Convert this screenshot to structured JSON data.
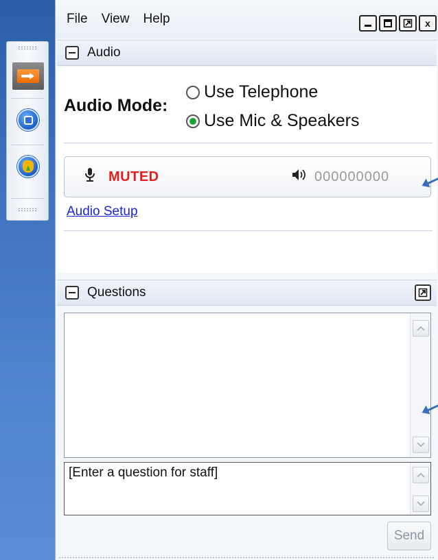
{
  "menu": {
    "items": [
      "File",
      "View",
      "Help"
    ]
  },
  "window_controls": {
    "minimize_icon": "minimize-icon",
    "maximize_icon": "maximize-icon",
    "restore_icon": "restore-icon",
    "close_glyph": "x"
  },
  "toolbar": {
    "buttons": [
      "forward-arrow-icon",
      "stop-square-icon",
      "raise-hand-icon"
    ]
  },
  "audio_panel": {
    "title": "Audio",
    "mode_label": "Audio Mode:",
    "options": [
      "Use Telephone",
      "Use Mic & Speakers"
    ],
    "selected": "Use Mic & Speakers",
    "mic_status": "MUTED",
    "speaker_value": "000000000",
    "setup_link": "Audio Setup"
  },
  "questions_panel": {
    "title": "Questions",
    "input_placeholder": "[Enter a question for staff]",
    "send_label": "Send"
  },
  "colors": {
    "muted": "#e31d1d",
    "link": "#1a23d6",
    "radio_selected": "#19a53a",
    "background_blue": "#3f73bf"
  }
}
